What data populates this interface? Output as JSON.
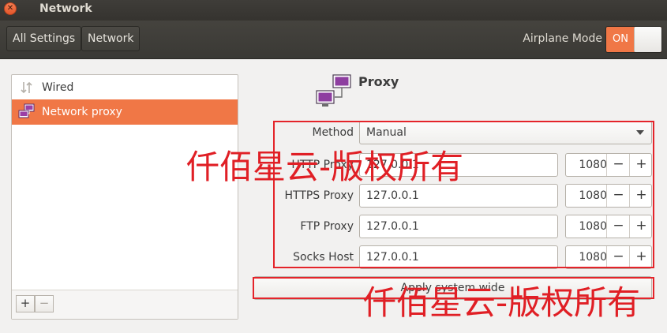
{
  "window": {
    "title": "Network"
  },
  "header": {
    "tabs": [
      "All Settings",
      "Network"
    ],
    "airplane_label": "Airplane Mode",
    "airplane_state": "ON"
  },
  "sidebar": {
    "items": [
      {
        "label": "Wired",
        "icon": "wired-icon",
        "active": false
      },
      {
        "label": "Network proxy",
        "icon": "network-proxy-icon",
        "active": true
      }
    ],
    "add_label": "+",
    "remove_label": "−"
  },
  "proxy": {
    "title": "Proxy",
    "method": {
      "label": "Method",
      "value": "Manual"
    },
    "rows": [
      {
        "label": "HTTP Proxy",
        "host": "127.0.0.1",
        "port": "1080"
      },
      {
        "label": "HTTPS Proxy",
        "host": "127.0.0.1",
        "port": "1080"
      },
      {
        "label": "FTP Proxy",
        "host": "127.0.0.1",
        "port": "1080"
      },
      {
        "label": "Socks Host",
        "host": "127.0.0.1",
        "port": "1080"
      }
    ],
    "minus": "−",
    "plus": "+",
    "apply_label": "Apply system wide"
  },
  "watermark": "仟佰星云-版权所有",
  "colors": {
    "accent": "#f07746",
    "annotation": "#e4242a"
  }
}
